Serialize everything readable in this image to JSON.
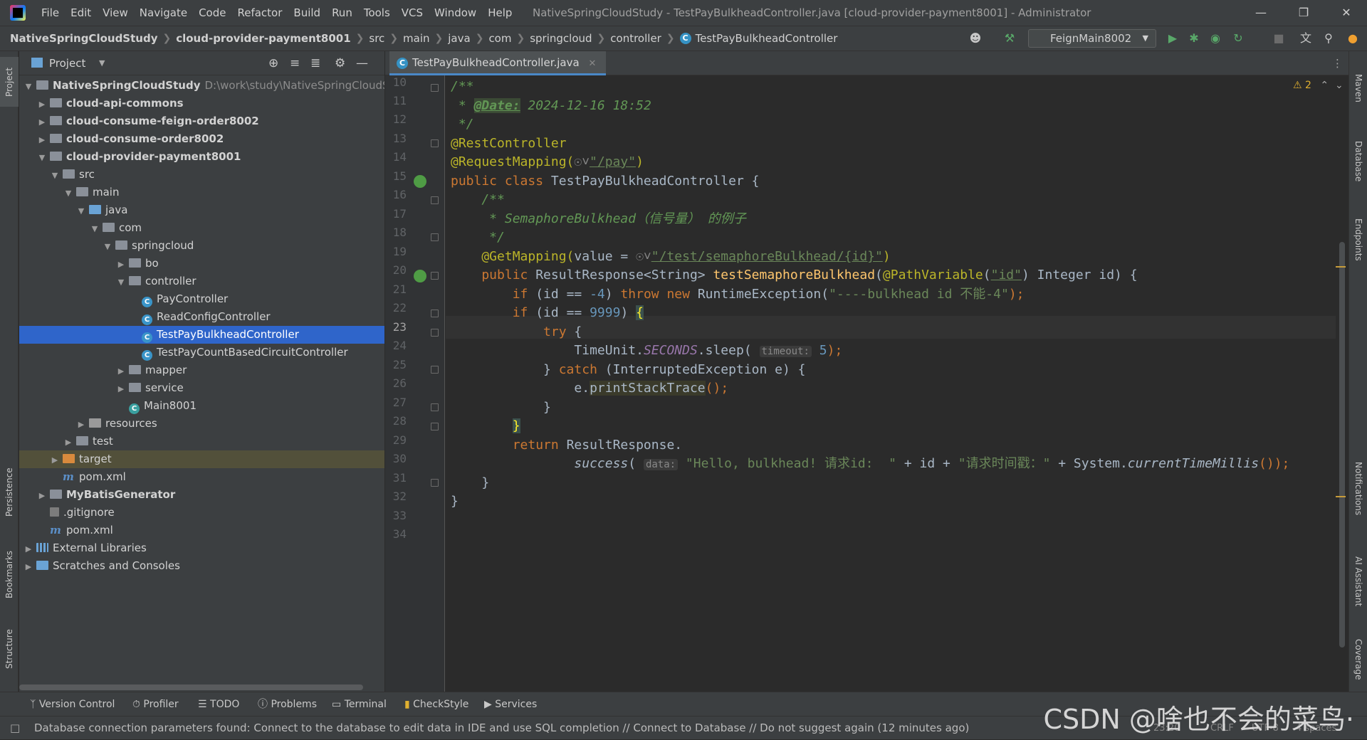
{
  "titlebar": {
    "menu": [
      "File",
      "Edit",
      "View",
      "Navigate",
      "Code",
      "Refactor",
      "Build",
      "Run",
      "Tools",
      "VCS",
      "Window",
      "Help"
    ],
    "window_title": "NativeSpringCloudStudy - TestPayBulkheadController.java [cloud-provider-payment8001] - Administrator"
  },
  "navbar": {
    "crumbs": [
      "NativeSpringCloudStudy",
      "cloud-provider-payment8001",
      "src",
      "main",
      "java",
      "com",
      "springcloud",
      "controller",
      "TestPayBulkheadController"
    ],
    "run_config": "FeignMain8002"
  },
  "project": {
    "title": "Project",
    "tree": [
      {
        "label": "NativeSpringCloudStudy",
        "path": "D:\\work\\study\\NativeSpringCloudSt",
        "bold": true
      },
      {
        "label": "cloud-api-commons"
      },
      {
        "label": "cloud-consume-feign-order8002"
      },
      {
        "label": "cloud-consume-order8002"
      },
      {
        "label": "cloud-provider-payment8001"
      },
      {
        "label": "src"
      },
      {
        "label": "main"
      },
      {
        "label": "java"
      },
      {
        "label": "com"
      },
      {
        "label": "springcloud"
      },
      {
        "label": "bo"
      },
      {
        "label": "controller"
      },
      {
        "label": "PayController"
      },
      {
        "label": "ReadConfigController"
      },
      {
        "label": "TestPayBulkheadController"
      },
      {
        "label": "TestPayCountBasedCircuitController"
      },
      {
        "label": "mapper"
      },
      {
        "label": "service"
      },
      {
        "label": "Main8001"
      },
      {
        "label": "resources"
      },
      {
        "label": "test"
      },
      {
        "label": "target"
      },
      {
        "label": "pom.xml"
      },
      {
        "label": "MyBatisGenerator"
      },
      {
        "label": ".gitignore"
      },
      {
        "label": "pom.xml"
      },
      {
        "label": "External Libraries"
      },
      {
        "label": "Scratches and Consoles"
      }
    ]
  },
  "editor": {
    "tab": "TestPayBulkheadController.java",
    "warnings": "2",
    "line_numbers": [
      "10",
      "11",
      "12",
      "13",
      "14",
      "15",
      "16",
      "17",
      "18",
      "19",
      "20",
      "21",
      "22",
      "23",
      "24",
      "25",
      "26",
      "27",
      "28",
      "29",
      "30",
      "31",
      "32",
      "33",
      "34"
    ],
    "current_line": "23",
    "code": {
      "l11": "/**",
      "l12_prefix": " * ",
      "l12_tag": "@Date:",
      "l12_rest": " 2024-12-16 18:52",
      "l13": " */",
      "l14": "@RestController",
      "l15_ann": "@RequestMapping(",
      "l15_str": "\"/pay\"",
      "l15_end": ")",
      "l16_kw": "public class ",
      "l16_name": "TestPayBulkheadController {",
      "l17": "    /**",
      "l18": "     * SemaphoreBulkhead（信号量） 的例子",
      "l19": "     */",
      "l20_ann": "    @GetMapping(",
      "l20_val": "value = ",
      "l20_str": "\"/test/semaphoreBulkhead/{id}\"",
      "l20_end": ")",
      "l21_kw": "    public ",
      "l21_type": "ResultResponse<String> ",
      "l21_fn": "testSemaphoreBulkhead",
      "l21_p1": "(",
      "l21_ann": "@PathVariable",
      "l21_p2": "(",
      "l21_str": "\"id\"",
      "l21_p3": ") Integer id) {",
      "l22_if": "        if ",
      "l22_cond": "(id == ",
      "l22_num": "-4",
      "l22_cp": ") ",
      "l22_throw": "throw new ",
      "l22_ex": "RuntimeException(",
      "l22_str": "\"----bulkhead id 不能-4\"",
      "l22_end": ");",
      "l23_if": "        if ",
      "l23_cond": "(id == ",
      "l23_num": "9999",
      "l23_cp": ") ",
      "l23_brace": "{",
      "l24_kw": "            try ",
      "l24_brace": "{",
      "l25_a": "                TimeUnit.",
      "l25_stat": "SECONDS",
      "l25_b": ".sleep( ",
      "l25_hint": "timeout:",
      "l25_num": " 5",
      "l25_end": ");",
      "l26_a": "            } ",
      "l26_kw": "catch ",
      "l26_b": "(InterruptedException e) {",
      "l27_a": "                e.",
      "l27_b": "printStackTrace",
      "l27_c": "();",
      "l28": "            }",
      "l29_brace": "}",
      "l30_kw": "        return ",
      "l30_b": "ResultResponse.",
      "l31_a": "                ",
      "l31_fn": "success",
      "l31_p": "( ",
      "l31_hint": "data:",
      "l31_s1": " \"Hello, bulkhead! 请求id:  \"",
      "l31_m1": " + id + ",
      "l31_s2": "\"请求时间戳：\"",
      "l31_m2": " + System.",
      "l31_fn2": "currentTimeMillis",
      "l31_end": "());",
      "l32": "    }",
      "l33": "}"
    }
  },
  "left_stripe": [
    "Project",
    "Persistence",
    "Bookmarks",
    "Structure"
  ],
  "right_stripe": [
    "Maven",
    "Database",
    "Endpoints",
    "Notifications",
    "AI Assistant",
    "Coverage"
  ],
  "bottom_tabs": [
    "Version Control",
    "Profiler",
    "TODO",
    "Problems",
    "Terminal",
    "CheckStyle",
    "Services"
  ],
  "status": {
    "message": "Database connection parameters found: Connect to the database to edit data in IDE and use SQL completion // Connect to Database // Do not suggest again (12 minutes ago)",
    "position": "23:20",
    "line_sep": "CRLF",
    "encoding": "UTF-8",
    "indent": "4 spaces"
  },
  "watermark": "CSDN @啥也不会的菜鸟·"
}
